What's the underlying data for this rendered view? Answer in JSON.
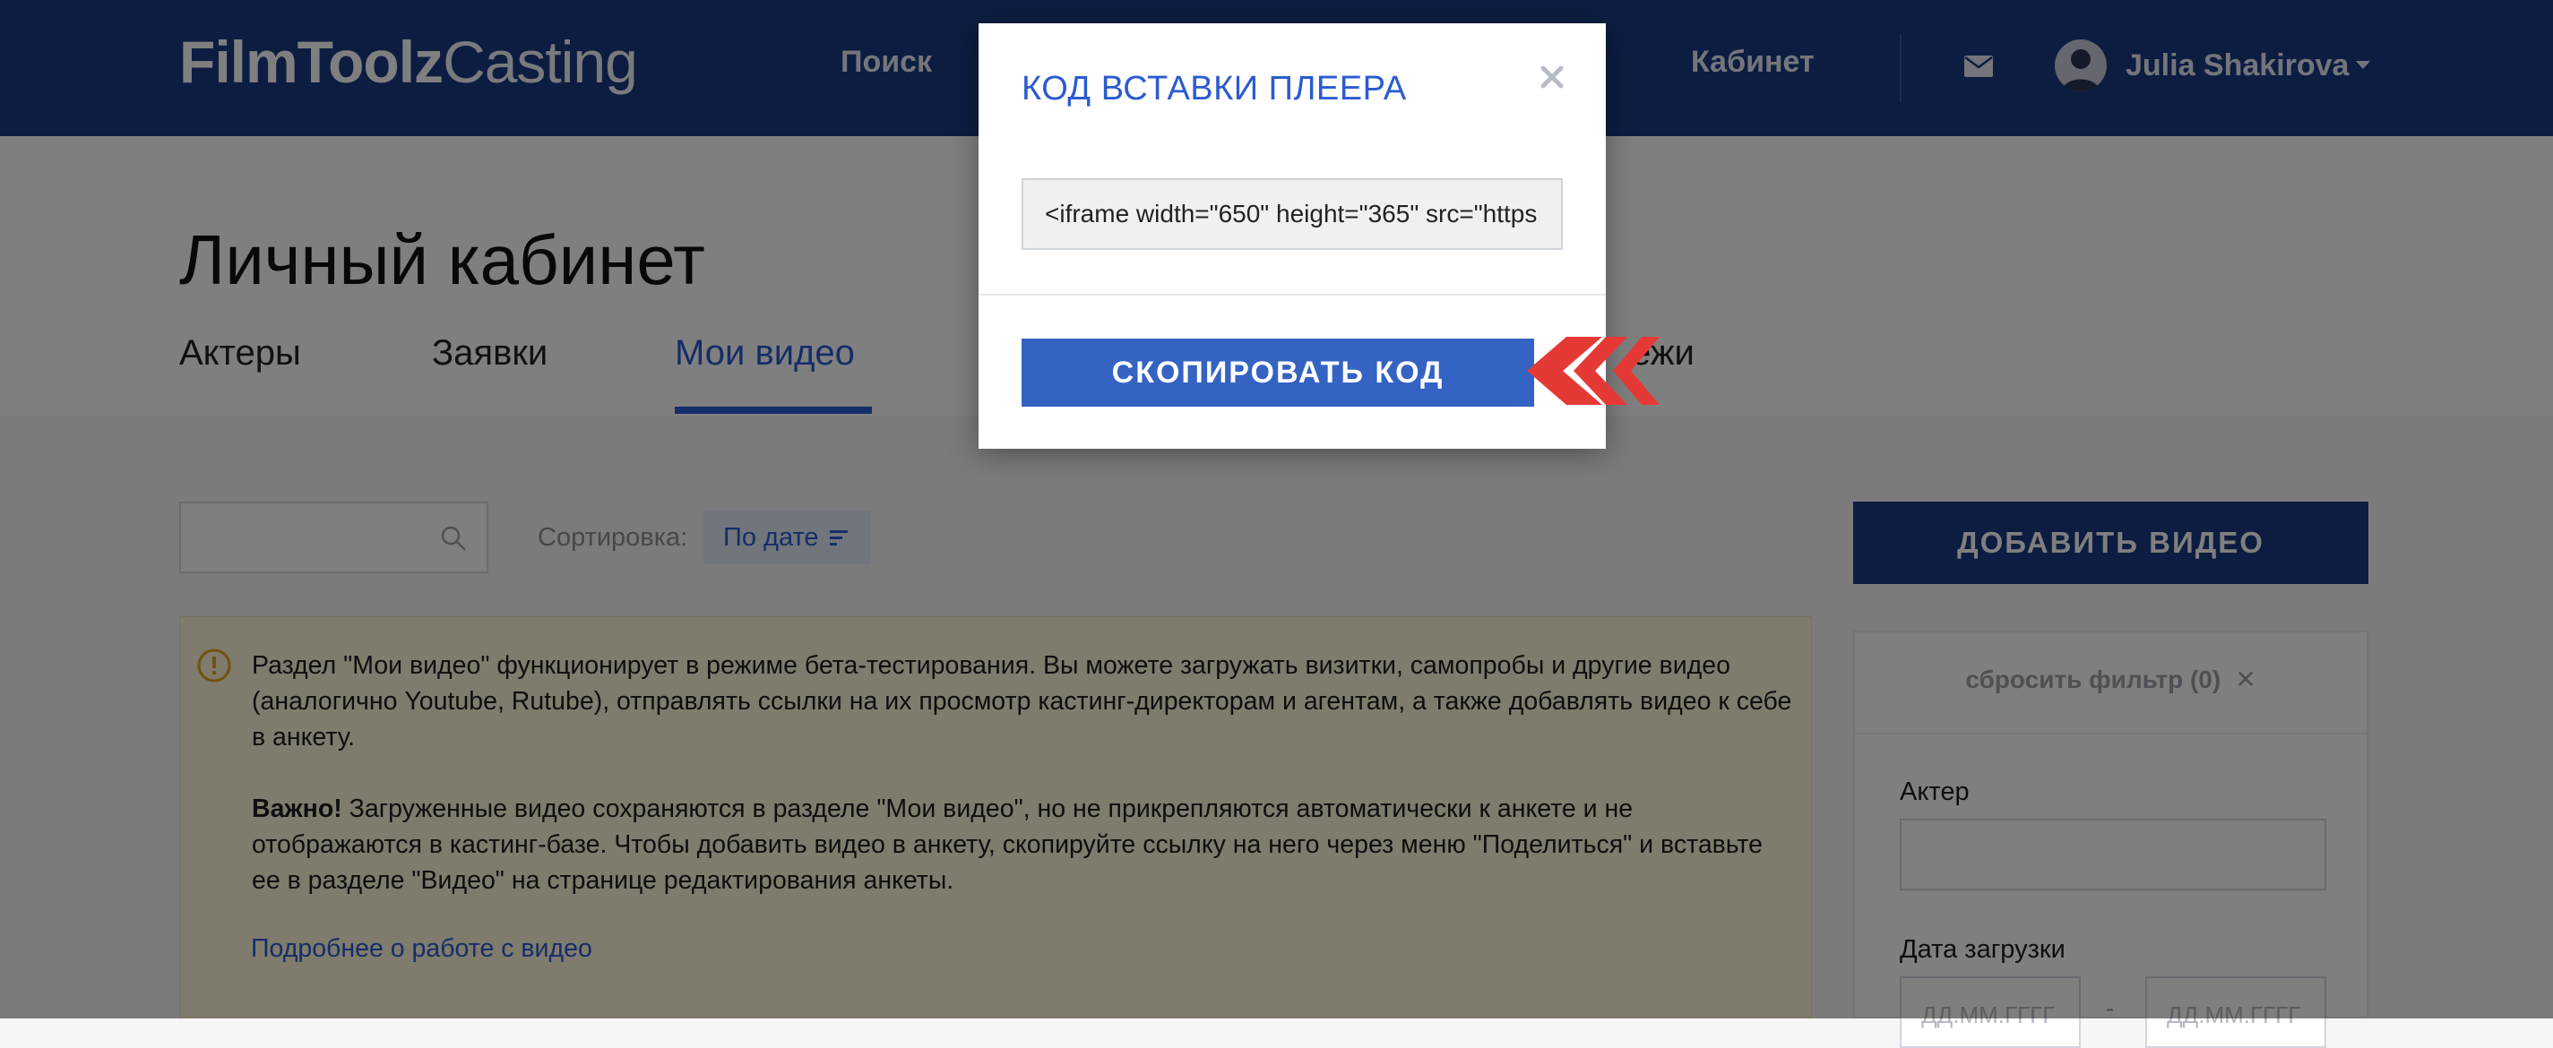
{
  "header": {
    "logo_bold": "FilmToolz",
    "logo_light": "Casting",
    "nav": {
      "search": "Поиск",
      "cabinet": "Кабинет"
    },
    "user_name": "Julia Shakirova"
  },
  "page": {
    "title": "Личный кабинет",
    "tabs": {
      "actors": "Актеры",
      "requests": "Заявки",
      "videos": "Мои видео",
      "extra": "ежи"
    }
  },
  "toolbar": {
    "sort_label": "Сортировка:",
    "sort_value": "По дате"
  },
  "notice": {
    "paragraph1": "Раздел \"Мои видео\" функционирует в режиме бета-тестирования. Вы можете загружать визитки, самопробы и другие видео (аналогично Youtube, Rutube), отправлять ссылки на их просмотр кастинг-директорам и агентам, а также добавлять видео к себе в анкету.",
    "important_label": "Важно!",
    "paragraph2": " Загруженные видео сохраняются в разделе \"Мои видео\", но не прикрепляются автоматически к анкете и не отображаются в кастинг-базе. Чтобы добавить видео в анкету, скопируйте ссылку на него через меню \"Поделиться\" и вставьте ее в разделе \"Видео\" на странице редактирования анкеты.",
    "link": "Подробнее о работе с видео"
  },
  "sidebar": {
    "add_video": "ДОБАВИТЬ ВИДЕО",
    "reset_filter": "сбросить фильтр (0)",
    "actor_label": "Актер",
    "date_label": "Дата загрузки",
    "date_from_placeholder": "ДД.ММ.ГГГГ",
    "date_to_placeholder": "ДД.ММ.ГГГГ"
  },
  "modal": {
    "title": "КОД ВСТАВКИ ПЛЕЕРА",
    "embed_code": "<iframe width=\"650\" height=\"365\" src=\"https:",
    "copy_button": "СКОПИРОВАТЬ КОД"
  },
  "colors": {
    "header_bg": "#1a3a82",
    "accent": "#2b5bd0",
    "copy_button": "#3463c4",
    "arrows": "#e53935",
    "notice_bg": "#fff6da"
  }
}
